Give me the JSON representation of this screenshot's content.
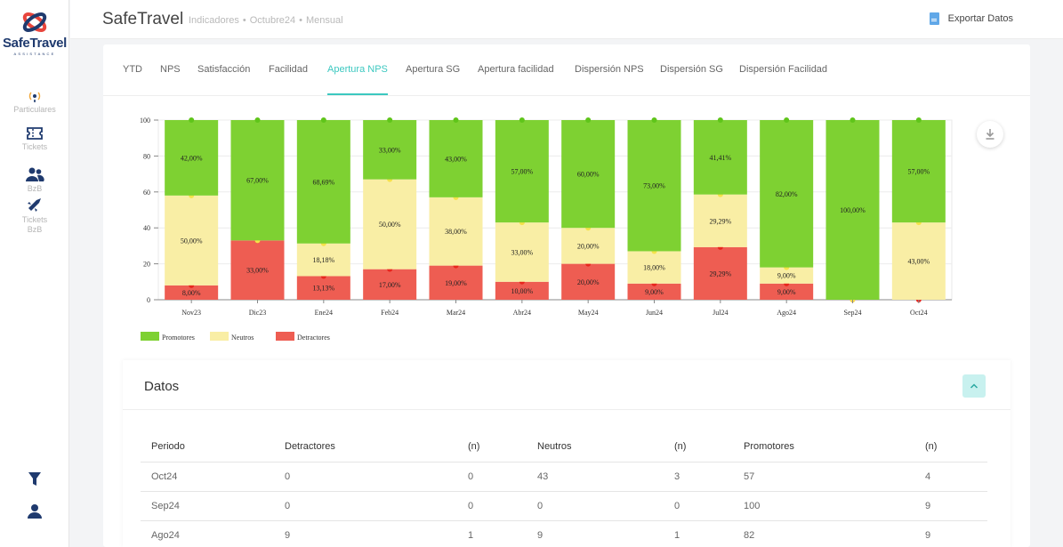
{
  "app": {
    "logo_text": "SafeTravel",
    "logo_sub": "ASSISTANCE",
    "title": "SafeTravel",
    "breadcrumbs": [
      "Indicadores",
      "Octubre24",
      "Mensual"
    ],
    "export_label": "Exportar Datos"
  },
  "sidebar": {
    "items": [
      {
        "label": "Particulares",
        "icon": "broadcast-icon"
      },
      {
        "label": "Tickets",
        "icon": "ticket-icon"
      },
      {
        "label": "BzB",
        "icon": "users-icon"
      },
      {
        "label": "Tickets BzB",
        "icon": "plane-ticket-icon"
      }
    ],
    "bottom": [
      {
        "icon": "filter-icon"
      },
      {
        "icon": "user-icon"
      }
    ]
  },
  "tabs": [
    "YTD",
    "NPS",
    "Satisfacción",
    "Facilidad",
    "Apertura NPS",
    "Apertura SG",
    "Apertura facilidad",
    "Dispersión NPS",
    "Dispersión SG",
    "Dispersión Facilidad"
  ],
  "active_tab": "Apertura NPS",
  "colors": {
    "accent": "#3cc8c0",
    "promotores": "#7ed132",
    "neutros": "#f9eea5",
    "detractores": "#ee5d52"
  },
  "chart_data": {
    "type": "bar",
    "stacked": true,
    "categories": [
      "Nov23",
      "Dic23",
      "Ene24",
      "Feb24",
      "Mar24",
      "Abr24",
      "May24",
      "Jun24",
      "Jul24",
      "Ago24",
      "Sep24",
      "Oct24"
    ],
    "series": [
      {
        "name": "Detractores",
        "values": [
          8,
          33,
          13.13,
          17,
          19,
          10,
          20,
          9,
          29.29,
          9,
          0,
          0
        ],
        "labels": [
          "8,00%",
          "33,00%",
          "13,13%",
          "17,00%",
          "19,00%",
          "10,00%",
          "20,00%",
          "9,00%",
          "29,29%",
          "9,00%",
          "",
          ""
        ]
      },
      {
        "name": "Neutros",
        "values": [
          50,
          0,
          18.18,
          50,
          38,
          33,
          20,
          18,
          29.29,
          9,
          0,
          43
        ],
        "labels": [
          "50,00%",
          "",
          "18,18%",
          "50,00%",
          "38,00%",
          "33,00%",
          "20,00%",
          "18,00%",
          "29,29%",
          "9,00%",
          "",
          "43,00%"
        ]
      },
      {
        "name": "Promotores",
        "values": [
          42,
          67,
          68.69,
          33,
          43,
          57,
          60,
          73,
          41.41,
          82,
          100,
          57
        ],
        "labels": [
          "42,00%",
          "67,00%",
          "68,69%",
          "33,00%",
          "43,00%",
          "57,00%",
          "60,00%",
          "73,00%",
          "41,41%",
          "82,00%",
          "100,00%",
          "57,00%"
        ]
      }
    ],
    "yticks": [
      0,
      20,
      40,
      60,
      80,
      100
    ],
    "ylim": [
      0,
      100
    ],
    "legend": "bottom-left"
  },
  "datos": {
    "title": "Datos",
    "columns": [
      "Periodo",
      "Detractores",
      "(n)",
      "Neutros",
      "(n)",
      "Promotores",
      "(n)"
    ],
    "rows": [
      [
        "Oct24",
        "0",
        "0",
        "43",
        "3",
        "57",
        "4"
      ],
      [
        "Sep24",
        "0",
        "0",
        "0",
        "0",
        "100",
        "9"
      ],
      [
        "Ago24",
        "9",
        "1",
        "9",
        "1",
        "82",
        "9"
      ]
    ]
  }
}
